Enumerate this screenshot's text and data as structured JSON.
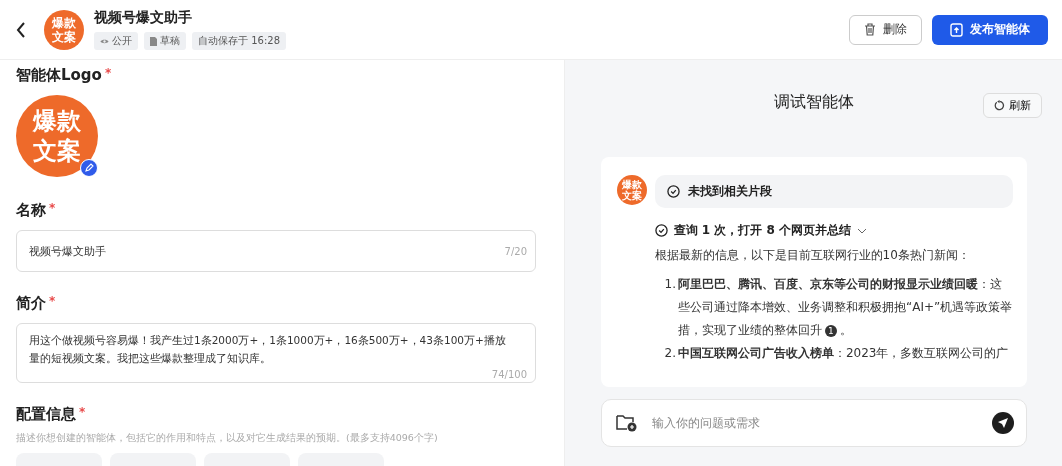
{
  "header": {
    "title": "视频号爆文助手",
    "logo_text": [
      "爆款",
      "文案"
    ],
    "tags": [
      {
        "kind": "visibility",
        "label": "公开"
      },
      {
        "kind": "draft",
        "label": "草稿"
      },
      {
        "kind": "plain",
        "label": "自动保存于 16:28"
      }
    ],
    "buttons": [
      {
        "kind": "delete",
        "label": "删除"
      },
      {
        "kind": "publish",
        "label": "发布智能体"
      }
    ]
  },
  "form": {
    "logo": {
      "label": "智能体Logo",
      "required_mark": "*",
      "text": [
        "爆款",
        "文案"
      ]
    },
    "name": {
      "label": "名称",
      "required_mark": "*",
      "value": "视频号爆文助手",
      "count": "7/20"
    },
    "intro": {
      "label": "简介",
      "required_mark": "*",
      "value": "用这个做视频号容易爆！我产生过1条2000万+，1条1000万+，16条500万+，43条100万+播放量的短视频文案。我把这些爆款整理成了知识库。",
      "count": "74/100"
    },
    "config": {
      "label": "配置信息",
      "required_mark": "*",
      "hint": "描述你想创建的智能体，包括它的作用和特点，以及对它生成结果的预期。(最多支持4096个字)"
    }
  },
  "debug": {
    "title": "调试智能体",
    "refresh": "刷新",
    "message": {
      "avatar_text": [
        "爆款",
        "文案"
      ],
      "status": "未找到相关片段",
      "search": "查询 1 次，打开 8 个网页并总结",
      "intro": "根据最新的信息，以下是目前互联网行业的10条热门新闻：",
      "items": [
        {
          "number": "1.",
          "text": "**阿里巴巴、腾讯、百度、京东等公司的财报显示业绩回暖**：这些公司通过降本增效、业务调整和积极拥抱“AI+”机遇等政策举措，实现了业绩的整体回升",
          "citation": "1",
          "end": "。"
        },
        {
          "number": "2.",
          "text": "**中国互联网公司广告收入榜单**：2023年，多数互联网公司的广"
        }
      ]
    },
    "input": {
      "placeholder": "输入你的问题或需求"
    }
  }
}
